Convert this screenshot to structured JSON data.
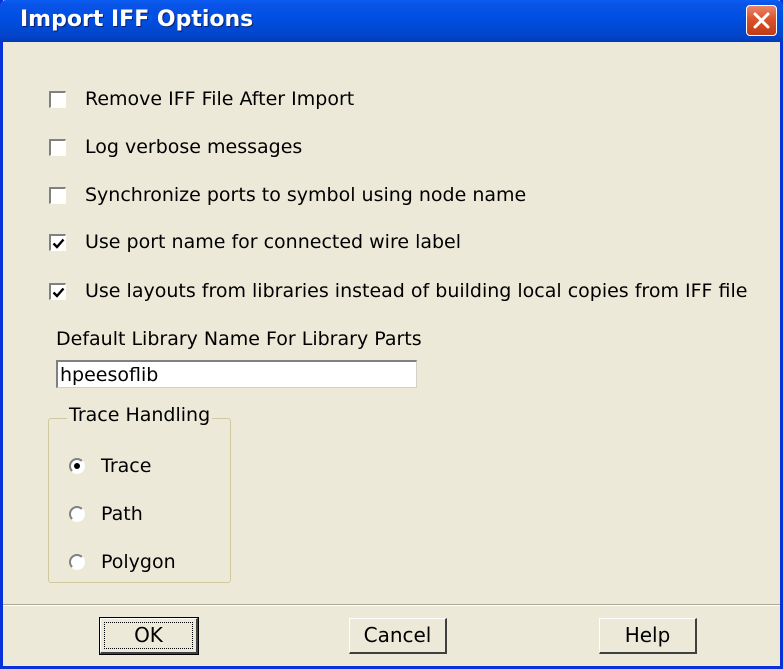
{
  "window": {
    "title": "Import IFF Options"
  },
  "options": [
    {
      "label": "Remove IFF File After Import",
      "checked": false
    },
    {
      "label": "Log verbose messages",
      "checked": false
    },
    {
      "label": "Synchronize ports to symbol using node name",
      "checked": false
    },
    {
      "label": "Use port name for connected wire label",
      "checked": true
    },
    {
      "label": "Use layouts from libraries instead of building local copies from IFF file",
      "checked": true
    }
  ],
  "library": {
    "label": "Default Library Name For Library Parts",
    "value": "hpeesoflib"
  },
  "trace_handling": {
    "legend": "Trace Handling",
    "selected": "Trace",
    "options": [
      "Trace",
      "Path",
      "Polygon"
    ]
  },
  "buttons": {
    "ok": "OK",
    "cancel": "Cancel",
    "help": "Help"
  },
  "icons": {
    "close": "close-icon",
    "check": "check-icon",
    "radio": "radio-dot-icon"
  }
}
